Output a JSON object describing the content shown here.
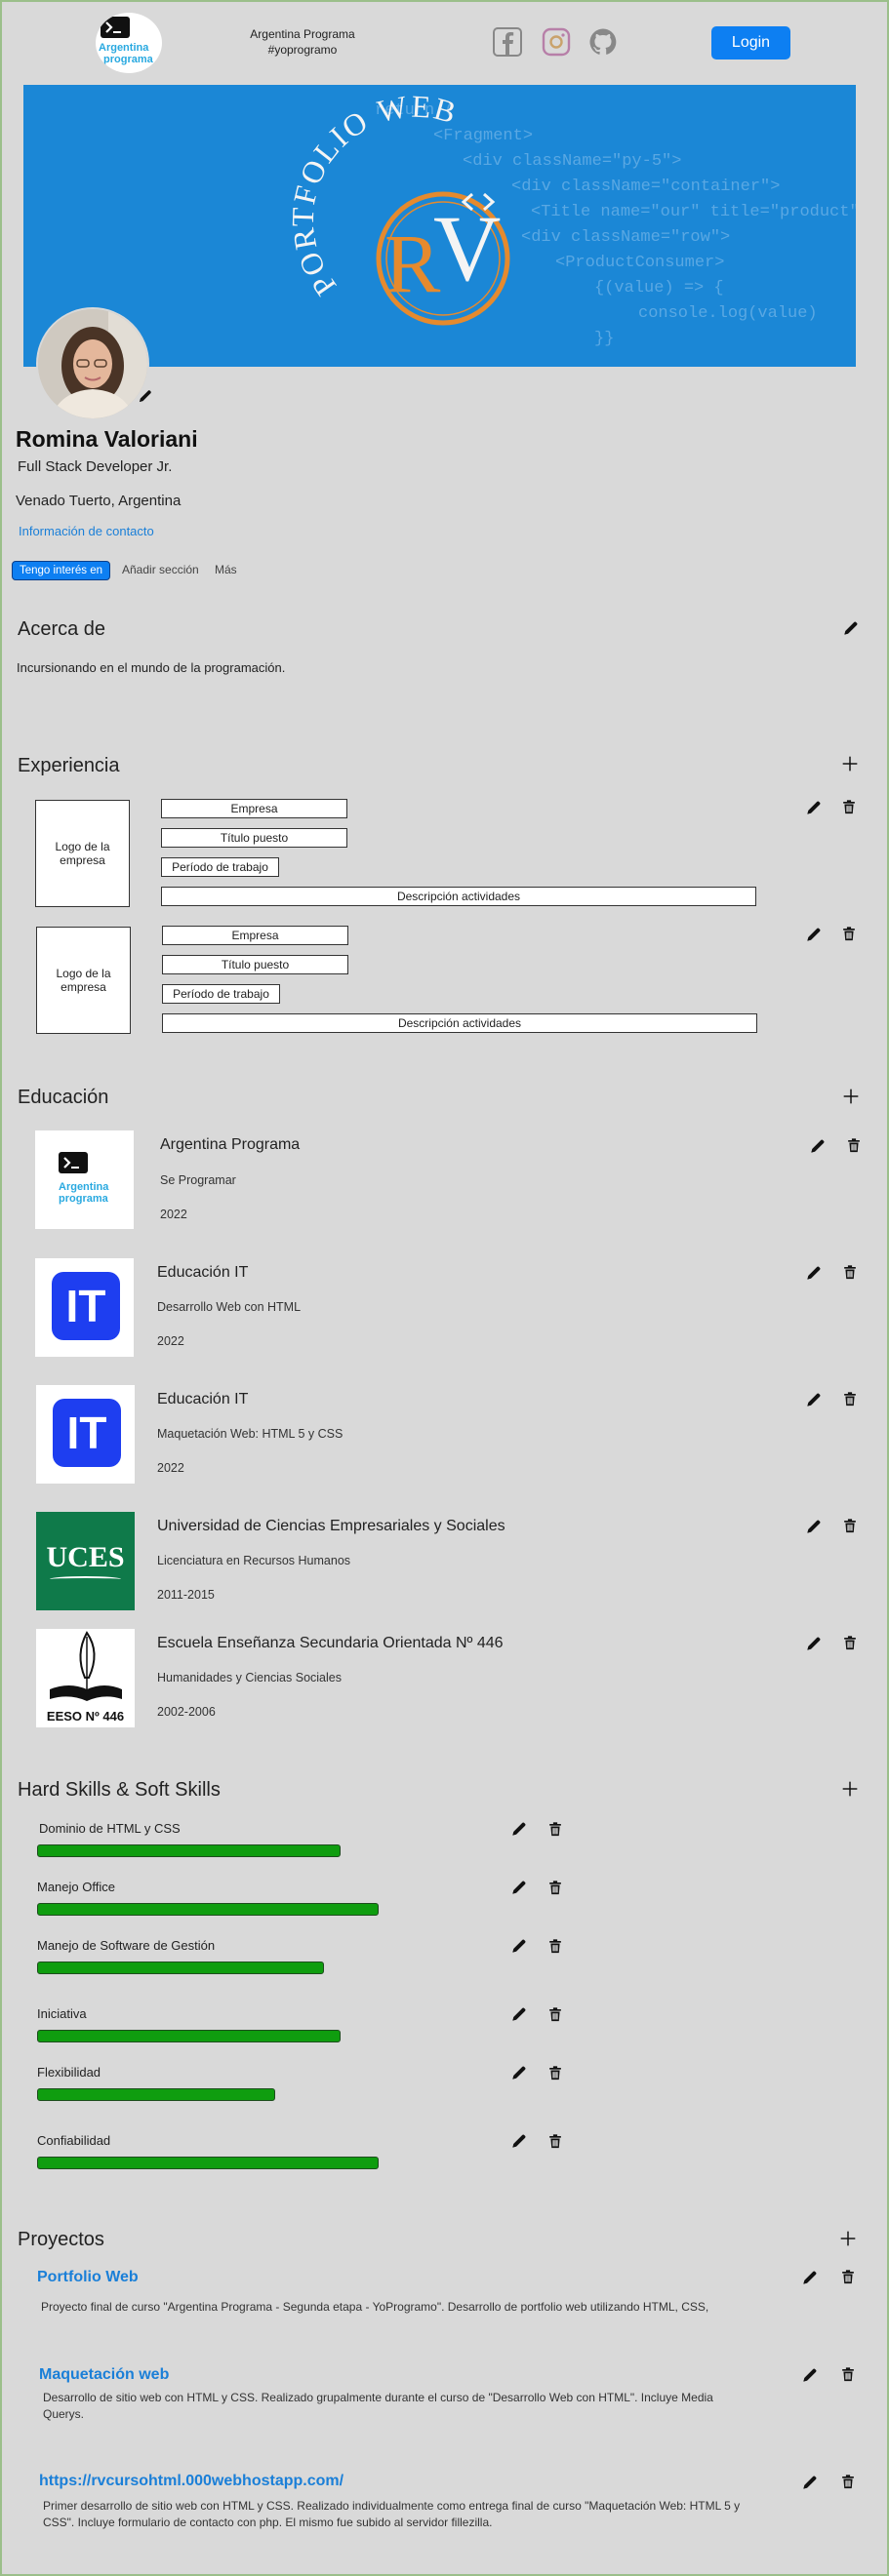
{
  "header": {
    "brand_line1": "Argentina Programa",
    "brand_line2": "#yoprogramo",
    "login": "Login",
    "logo_text_top": "Argentina",
    "logo_text_bottom": "programa"
  },
  "banner": {
    "title": "PORTFOLIO WEB",
    "monogram_r": "R",
    "monogram_v": "V",
    "code_lines": [
      "return (",
      "<Fragment>",
      "<div className=\"py-5\">",
      "<div className=\"container\">",
      "<Title name=\"our\" title=\"product\"",
      "<div className=\"row\">",
      "<ProductConsumer>",
      "{(value) => {",
      "console.log(value)",
      "}}"
    ]
  },
  "profile": {
    "name": "Romina Valoriani",
    "role": "Full Stack Developer Jr.",
    "location": "Venado Tuerto, Argentina",
    "contact": "Información de contacto",
    "btn_interest": "Tengo interés en",
    "btn_add": "Añadir sección",
    "btn_more": "Más"
  },
  "about": {
    "title": "Acerca de",
    "text": "Incursionando en el mundo de la programación."
  },
  "experience": {
    "title": "Experiencia",
    "items": [
      {
        "logo": "Logo de la empresa",
        "company": "Empresa",
        "position": "Título puesto",
        "period": "Período de trabajo",
        "description": "Descripción actividades"
      },
      {
        "logo": "Logo de la empresa",
        "company": "Empresa",
        "position": "Título puesto",
        "period": "Período de trabajo",
        "description": "Descripción actividades"
      }
    ]
  },
  "education": {
    "title": "Educación",
    "items": [
      {
        "institution": "Argentina Programa",
        "course": "Se Programar",
        "period": "2022"
      },
      {
        "institution": "Educación IT",
        "course": "Desarrollo Web con HTML",
        "period": "2022"
      },
      {
        "institution": "Educación IT",
        "course": "Maquetación Web: HTML 5 y CSS",
        "period": "2022"
      },
      {
        "institution": "Universidad de Ciencias Empresariales y Sociales",
        "course": "Licenciatura en Recursos Humanos",
        "period": "2011-2015"
      },
      {
        "institution": "Escuela Enseñanza Secundaria Orientada Nº 446",
        "course": "Humanidades y Ciencias Sociales",
        "period": "2002-2006"
      }
    ],
    "logo_ap_top": "Argentina",
    "logo_ap_bottom": "programa",
    "logo_it": "IT",
    "logo_uces": "UCES",
    "logo_eeso": "EESO Nº 446"
  },
  "skills": {
    "title": "Hard Skills & Soft Skills",
    "items": [
      {
        "name": "Dominio de HTML y CSS",
        "level": 0.56
      },
      {
        "name": "Manejo Office",
        "level": 0.63
      },
      {
        "name": "Manejo de Software de Gestión",
        "level": 0.53
      },
      {
        "name": "Iniciativa",
        "level": 0.56
      },
      {
        "name": "Flexibilidad",
        "level": 0.44
      },
      {
        "name": "Confiabilidad",
        "level": 0.63
      }
    ]
  },
  "projects": {
    "title": "Proyectos",
    "items": [
      {
        "title": "Portfolio Web",
        "description": "Proyecto final de curso \"Argentina Programa - Segunda etapa - YoProgramo\". Desarrollo de portfolio web utilizando HTML, CSS,"
      },
      {
        "title": "Maquetación web",
        "description": "Desarrollo de sitio web con HTML y CSS. Realizado grupalmente durante el curso de  \"Desarrollo Web con HTML\". Incluye Media Querys."
      },
      {
        "title": "https://rvcursohtml.000webhostapp.com/",
        "description": "Primer desarrollo de sitio web con HTML y CSS. Realizado individualmente como entrega final de curso \"Maquetación Web: HTML 5 y CSS\". Incluye formulario de contacto con php. El mismo fue subido al servidor fillezilla."
      }
    ]
  },
  "colors": {
    "accent": "#0d7ff2",
    "banner": "#1b87d6",
    "skill_bar": "#0f9d0f",
    "background": "#d9d9d9"
  },
  "icons": [
    "pencil-icon",
    "trash-icon",
    "plus-icon",
    "facebook-icon",
    "instagram-icon",
    "github-icon"
  ]
}
